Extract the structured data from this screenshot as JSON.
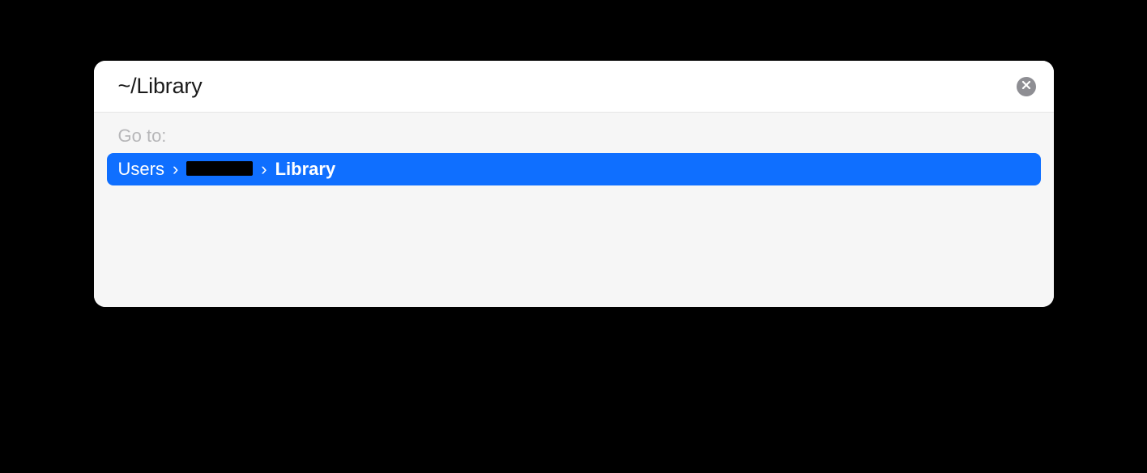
{
  "input": {
    "value": "~/Library"
  },
  "goto_label": "Go to:",
  "result": {
    "segments": [
      {
        "text": "Users",
        "bold": false
      },
      {
        "text": "",
        "redacted": true,
        "bold": false
      },
      {
        "text": "Library",
        "bold": true
      }
    ],
    "separator": "›"
  }
}
